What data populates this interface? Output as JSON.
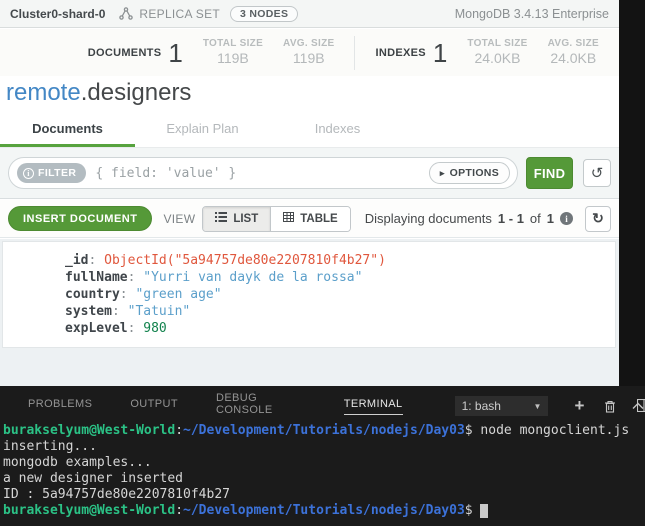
{
  "palette": {
    "compass_green": "#559938",
    "tab_active_underline": "#57a33e",
    "namespace_db_blue": "#4387c5",
    "objectid_color": "#e0573d",
    "string_color": "#5b9fca",
    "number_color": "#12824d",
    "terminal_bg": "#1b1b1b",
    "terminal_green": "#2bc286",
    "terminal_blue": "#3c72d9"
  },
  "compass": {
    "topbar": {
      "cluster": "Cluster0-shard-0",
      "replica_set_label": "REPLICA SET",
      "nodes_badge": "3 NODES",
      "version": "MongoDB 3.4.13 Enterprise"
    },
    "stats_groups": [
      {
        "name": "DOCUMENTS",
        "count": "1",
        "metrics": [
          {
            "label": "TOTAL SIZE",
            "value": "119B"
          },
          {
            "label": "AVG. SIZE",
            "value": "119B"
          }
        ]
      },
      {
        "name": "INDEXES",
        "count": "1",
        "metrics": [
          {
            "label": "TOTAL SIZE",
            "value": "24.0KB"
          },
          {
            "label": "AVG. SIZE",
            "value": "24.0KB"
          }
        ]
      }
    ],
    "namespace": {
      "db": "remote",
      "collection": ".designers"
    },
    "tabs": [
      {
        "label": "Documents",
        "active": true
      },
      {
        "label": "Explain Plan",
        "active": false
      },
      {
        "label": "Indexes",
        "active": false
      }
    ],
    "filter": {
      "badge_label": "FILTER",
      "info_glyph": "i",
      "placeholder": "{ field: 'value' }",
      "options_label": "OPTIONS",
      "options_caret": "▸",
      "find_label": "FIND",
      "history_icon": "↺"
    },
    "actions": {
      "insert_label": "INSERT DOCUMENT",
      "view_label": "VIEW",
      "list_label": "LIST",
      "table_label": "TABLE",
      "displaying_prefix": "Displaying documents",
      "range": "1 - 1",
      "of_label": "of",
      "total": "1",
      "info_glyph": "i",
      "refresh_icon": "↻"
    },
    "document": {
      "fields": [
        {
          "key": "_id",
          "value": "ObjectId(\"5a94757de80e2207810f4b27\")",
          "type": "objectid"
        },
        {
          "key": "fullName",
          "value": "\"Yurri van dayk de la rossa\"",
          "type": "string"
        },
        {
          "key": "country",
          "value": "\"green age\"",
          "type": "string"
        },
        {
          "key": "system",
          "value": "\"Tatuin\"",
          "type": "string"
        },
        {
          "key": "expLevel",
          "value": "980",
          "type": "number"
        }
      ]
    }
  },
  "terminal": {
    "tabs": [
      {
        "label": "PROBLEMS",
        "active": false
      },
      {
        "label": "OUTPUT",
        "active": false
      },
      {
        "label": "DEBUG CONSOLE",
        "active": false
      },
      {
        "label": "TERMINAL",
        "active": true
      }
    ],
    "shell_select": "1: bash",
    "shell_caret": "▼",
    "plus_glyph": "+",
    "lines": [
      {
        "segments": [
          {
            "text": "burakselyum@West-World",
            "color": "green"
          },
          {
            "text": ":",
            "color": "fg"
          },
          {
            "text": "~/Development/Tutorials/nodejs/Day03",
            "color": "blue"
          },
          {
            "text": "$ node mongoclient.js",
            "color": "fg"
          }
        ]
      },
      {
        "segments": [
          {
            "text": "inserting...",
            "color": "fg"
          }
        ]
      },
      {
        "segments": [
          {
            "text": "mongodb examples...",
            "color": "fg"
          }
        ]
      },
      {
        "segments": [
          {
            "text": "a new designer inserted",
            "color": "fg"
          }
        ]
      },
      {
        "segments": [
          {
            "text": "ID : 5a94757de80e2207810f4b27",
            "color": "fg"
          }
        ]
      },
      {
        "segments": [
          {
            "text": "burakselyum@West-World",
            "color": "green"
          },
          {
            "text": ":",
            "color": "fg"
          },
          {
            "text": "~/Development/Tutorials/nodejs/Day03",
            "color": "blue"
          },
          {
            "text": "$ ",
            "color": "fg"
          }
        ],
        "cursor": true
      }
    ]
  }
}
